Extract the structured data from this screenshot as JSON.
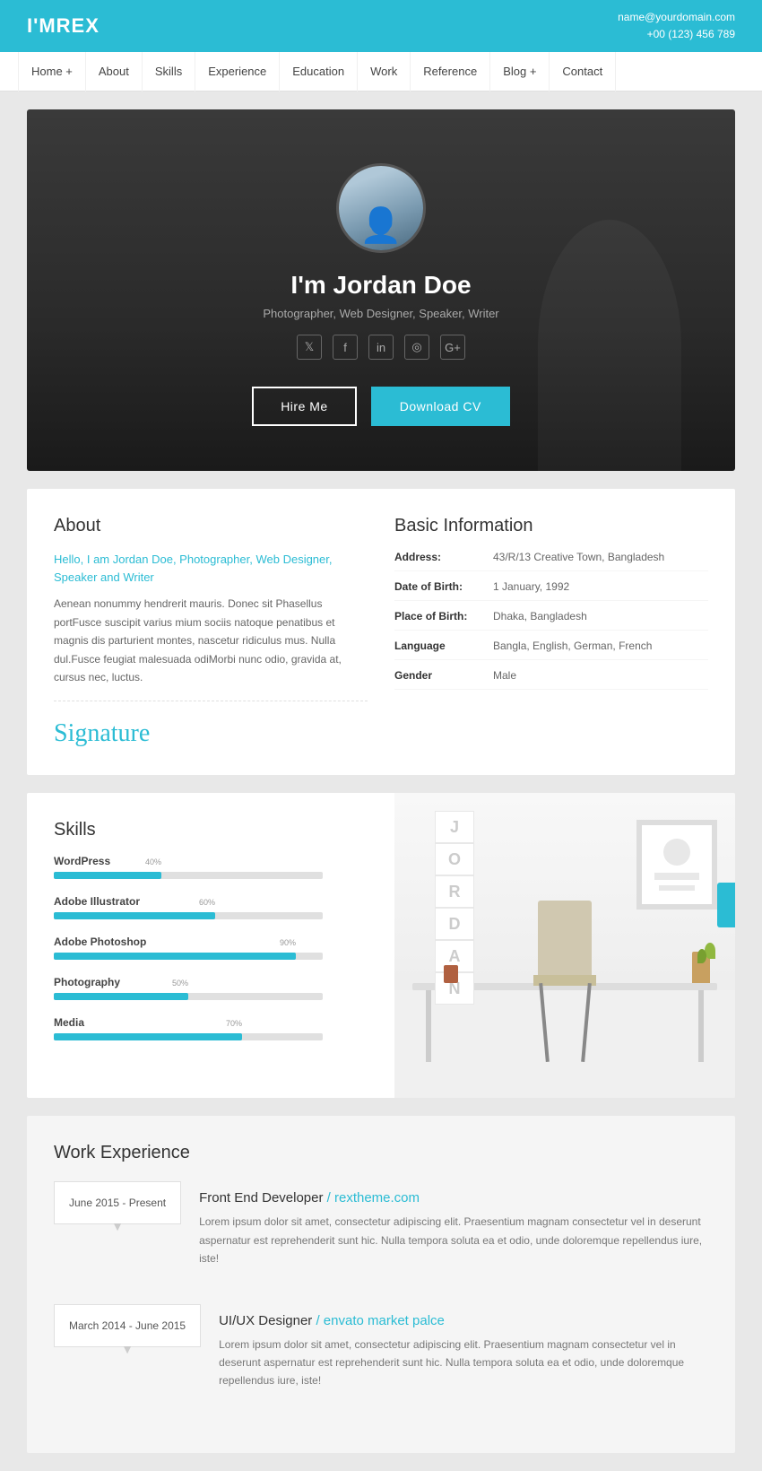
{
  "header": {
    "logo": "I'MREX",
    "contact_email": "name@yourdomain.com",
    "contact_phone": "+00 (123) 456 789"
  },
  "nav": {
    "items": [
      "Home",
      "+",
      "About",
      "Skills",
      "Experience",
      "Education",
      "Work",
      "Reference",
      "Blog",
      "+",
      "Contact"
    ]
  },
  "hero": {
    "name": "I'm Jordan Doe",
    "title": "Photographer, Web Designer, Speaker, Writer",
    "btn_hire": "Hire Me",
    "btn_cv": "Download CV",
    "social_icons": [
      "𝕏",
      "f",
      "in",
      "📷",
      "G+"
    ]
  },
  "about": {
    "title": "About",
    "highlight": "Hello, I am Jordan Doe, Photographer, Web Designer, Speaker and Writer",
    "text": "Aenean nonummy hendrerit mauris. Donec sit Phasellus portFusce suscipit varius mium sociis natoque penatibus et magnis dis parturient montes, nascetur ridiculus mus. Nulla dul.Fusce feugiat malesuada odiMorbi nunc odio, gravida at, cursus nec, luctus.",
    "signature": "Signature"
  },
  "basic_info": {
    "title": "Basic Information",
    "rows": [
      {
        "label": "Address:",
        "value": "43/R/13 Creative Town, Bangladesh"
      },
      {
        "label": "Date of Birth:",
        "value": "1 January, 1992"
      },
      {
        "label": "Place of Birth:",
        "value": "Dhaka, Bangladesh"
      },
      {
        "label": "Language",
        "value": "Bangla, English, German, French"
      },
      {
        "label": "Gender",
        "value": "Male"
      }
    ]
  },
  "skills": {
    "title": "Skills",
    "items": [
      {
        "name": "WordPress",
        "pct": 40
      },
      {
        "name": "Adobe Illustrator",
        "pct": 60
      },
      {
        "name": "Adobe Photoshop",
        "pct": 90
      },
      {
        "name": "Photography",
        "pct": 50
      },
      {
        "name": "Media",
        "pct": 70
      }
    ]
  },
  "experience": {
    "title": "Work Experience",
    "items": [
      {
        "date": "June 2015 - Present",
        "job_title": "Front End Developer",
        "company_link_text": "/ rextheme.com",
        "company_link": "#",
        "desc": "Lorem ipsum dolor sit amet, consectetur adipiscing elit. Praesentium magnam consectetur vel in deserunt aspernatur est reprehenderit sunt hic. Nulla tempora soluta ea et odio, unde doloremque repellendus iure, iste!"
      },
      {
        "date": "March 2014 - June 2015",
        "job_title": "UI/UX Designer",
        "company_link_text": "/ envato market palce",
        "company_link": "#",
        "desc": "Lorem ipsum dolor sit amet, consectetur adipiscing elit. Praesentium magnam consectetur vel in deserunt aspernatur est reprehenderit sunt hic. Nulla tempora soluta ea et odio, unde doloremque repellendus iure, iste!"
      }
    ]
  },
  "desk_letters": [
    "J",
    "O",
    "R",
    "D",
    "A",
    "N"
  ]
}
